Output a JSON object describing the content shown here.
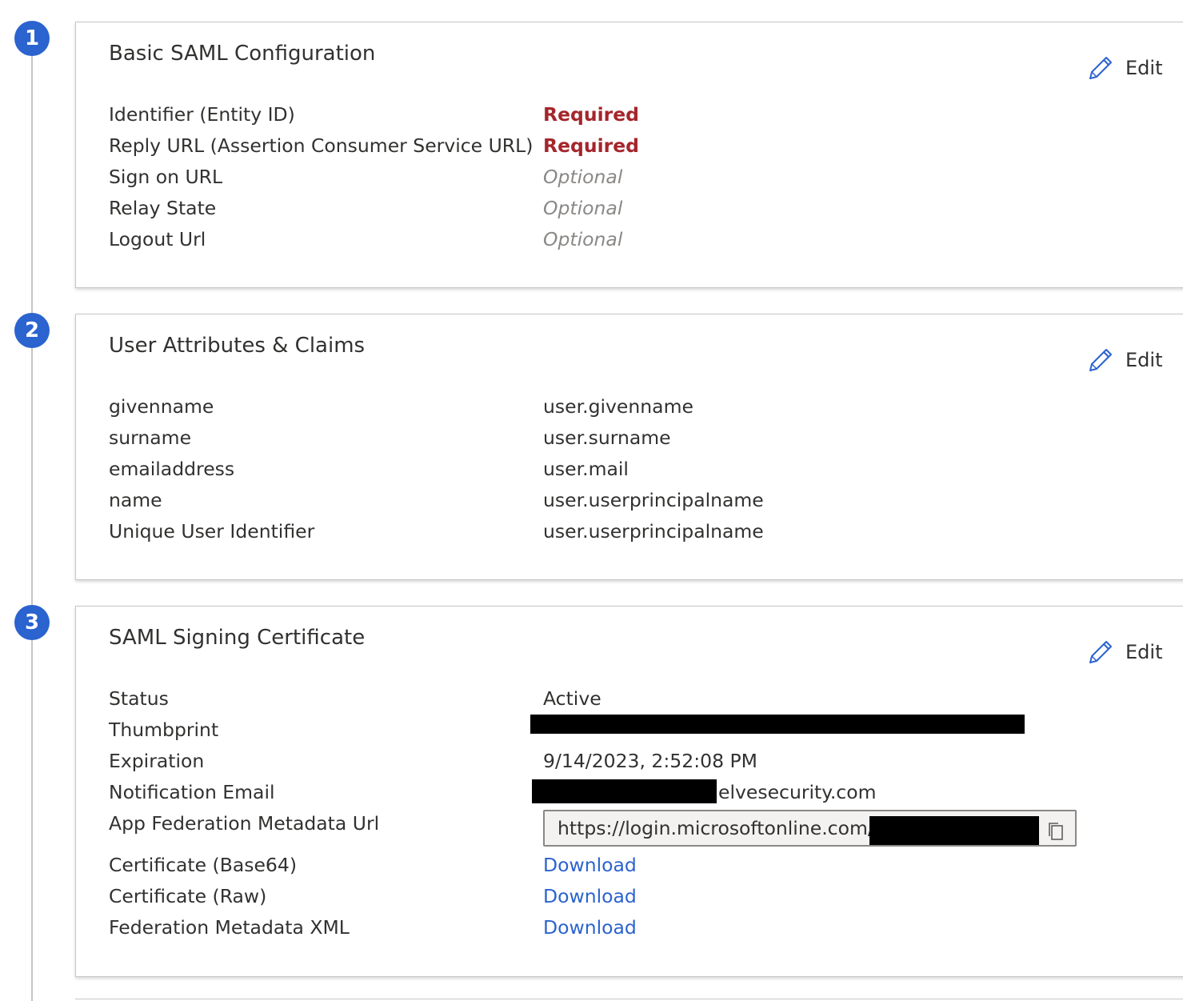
{
  "steps": [
    {
      "number": "1",
      "title": "Basic SAML Configuration",
      "edit_label": "Edit",
      "rows": [
        {
          "label": "Identifier (Entity ID)",
          "value": "Required"
        },
        {
          "label": "Reply URL (Assertion Consumer Service URL)",
          "value": "Required"
        },
        {
          "label": "Sign on URL",
          "value": "Optional"
        },
        {
          "label": "Relay State",
          "value": "Optional"
        },
        {
          "label": "Logout Url",
          "value": "Optional"
        }
      ]
    },
    {
      "number": "2",
      "title": "User Attributes & Claims",
      "edit_label": "Edit",
      "rows": [
        {
          "label": "givenname",
          "value": "user.givenname"
        },
        {
          "label": "surname",
          "value": "user.surname"
        },
        {
          "label": "emailaddress",
          "value": "user.mail"
        },
        {
          "label": "name",
          "value": "user.userprincipalname"
        },
        {
          "label": "Unique User Identifier",
          "value": "user.userprincipalname"
        }
      ]
    },
    {
      "number": "3",
      "title": "SAML Signing Certificate",
      "edit_label": "Edit",
      "rows": [
        {
          "label": "Status",
          "value": "Active"
        },
        {
          "label": "Thumbprint",
          "value": ""
        },
        {
          "label": "Expiration",
          "value": "9/14/2023, 2:52:08 PM"
        },
        {
          "label": "Notification Email",
          "value": "elvesecurity.com"
        },
        {
          "label": "App Federation Metadata Url",
          "value": "https://login.microsoftonline.com/"
        },
        {
          "label": "Certificate (Base64)",
          "value": "Download"
        },
        {
          "label": "Certificate (Raw)",
          "value": "Download"
        },
        {
          "label": "Federation Metadata XML",
          "value": "Download"
        }
      ]
    }
  ],
  "icons": {
    "edit": "pencil-icon",
    "copy": "copy-icon"
  },
  "colors": {
    "accent": "#2b63cf",
    "required": "#a4262c",
    "optional": "#8a8886",
    "redaction": "#000000"
  }
}
